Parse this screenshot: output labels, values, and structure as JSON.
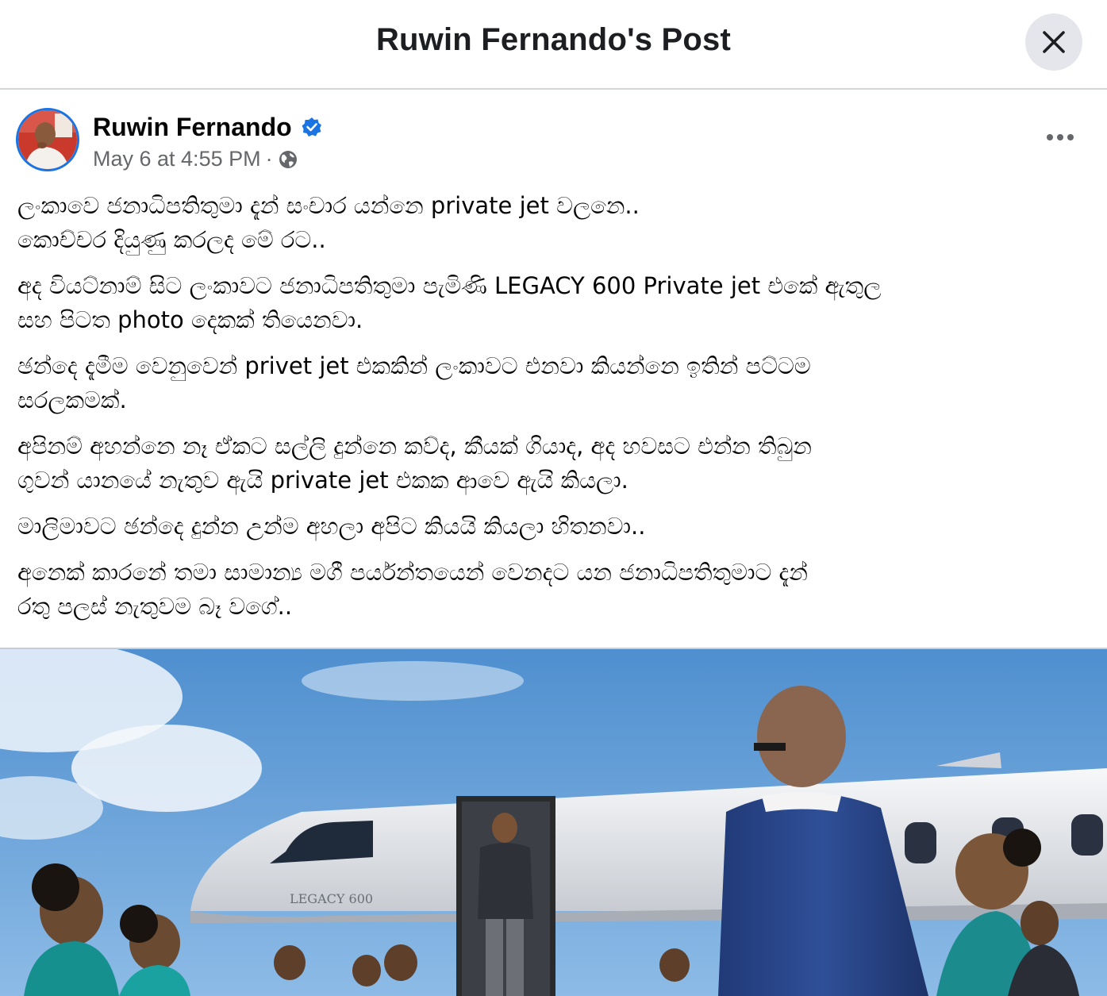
{
  "dialog": {
    "title": "Ruwin Fernando's Post",
    "close_icon": "close-icon"
  },
  "post": {
    "author": "Ruwin Fernando",
    "verified_icon": "verified-badge-icon",
    "timestamp": "May 6 at 4:55 PM",
    "separator": "·",
    "audience_icon": "globe-icon",
    "more_icon": "more-options-icon",
    "paragraphs": [
      "ලංකාවෙ ජනාධිපතිතුමා දැන් සංචාර යන්නෙ private jet වලනෙ..\nකොච්චර දියුණු කරලද මේ රට..",
      "අද වියට්නාම් සිට ලංකාවට ජනාධිපතිතුමා පැමිණි LEGACY 600 Private jet එකේ ඇතුල\nසහ පිටත photo දෙකක් තියෙනවා.",
      "ඡන්දෙ දැමීම වෙනුවෙන් privet jet එකකින් ලංකාවට එනවා කියන්නෙ ඉතින් පට්ටම\nසරලකමක්.",
      "අපිනම් අහන්නෙ නෑ ඒකට සල්ලි දුන්නෙ කව්ද, කීයක් ගියාද, අද හවසට එන්න තිබුන\nගුවන් යානයේ නැතුව ඇයි private jet එකක ආවෙ ඇයි කියලා.",
      "මාලිමාවට ඡන්දෙ දුන්න උන්ම අහලා අපිට කියයි කියලා හිතනවා..",
      "අනෙක් කාරනේ තමා සාමාන්‍ය මගී පර්යන්තයෙන් වෙනදට යන ජනාධිපතිතුමාට දැන්\nරතු පලස් නැතුවම බෑ වගේ.."
    ],
    "photo": {
      "aircraft_lettering": "LEGACY 600"
    }
  },
  "colors": {
    "accent": "#1b74e4",
    "meta_text": "#65676b",
    "close_bg": "#e4e6eb",
    "sky": "#6aa3d8"
  }
}
